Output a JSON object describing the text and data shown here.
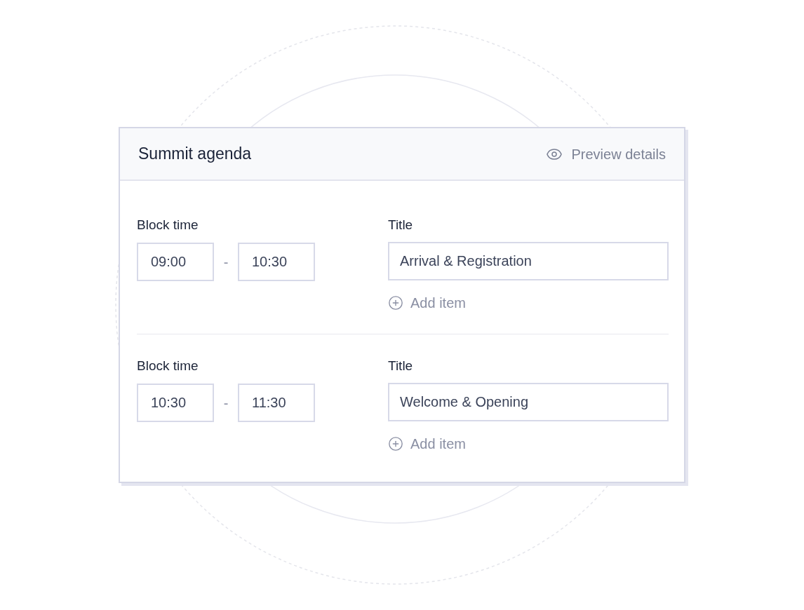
{
  "card": {
    "title": "Summit agenda",
    "preview_link": "Preview details"
  },
  "blocks": [
    {
      "time_label": "Block time",
      "start": "09:00",
      "separator": "-",
      "end": "10:30",
      "title_label": "Title",
      "title": "Arrival & Registration",
      "add_item": "Add item"
    },
    {
      "time_label": "Block time",
      "start": "10:30",
      "separator": "-",
      "end": "11:30",
      "title_label": "Title",
      "title": "Welcome & Opening",
      "add_item": "Add item"
    }
  ]
}
